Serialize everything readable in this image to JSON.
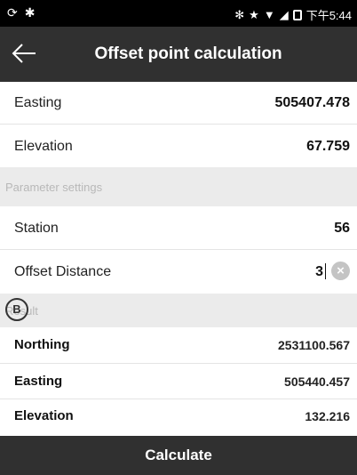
{
  "status_bar": {
    "left_icons": [
      "sync-icon",
      "android-icon"
    ],
    "right_icons": [
      "bluetooth-icon",
      "star-icon",
      "wifi-icon",
      "signal-icon",
      "battery-icon"
    ],
    "time": "下午5:44"
  },
  "header": {
    "title": "Offset point calculation",
    "back_icon": "arrow-left-icon"
  },
  "point": {
    "easting_label": "Easting",
    "easting_value": "505407.478",
    "elevation_label": "Elevation",
    "elevation_value": "67.759"
  },
  "parameters": {
    "section_title": "Parameter settings",
    "station_label": "Station",
    "station_value": "56",
    "offset_label": "Offset Distance",
    "offset_value": "3"
  },
  "result": {
    "section_title": "Result",
    "save_icon": "B",
    "northing_label": "Northing",
    "northing_value": "2531100.567",
    "easting_label": "Easting",
    "easting_value": "505440.457",
    "elevation_label": "Elevation",
    "elevation_value": "132.216"
  },
  "footer": {
    "calculate_label": "Calculate"
  }
}
